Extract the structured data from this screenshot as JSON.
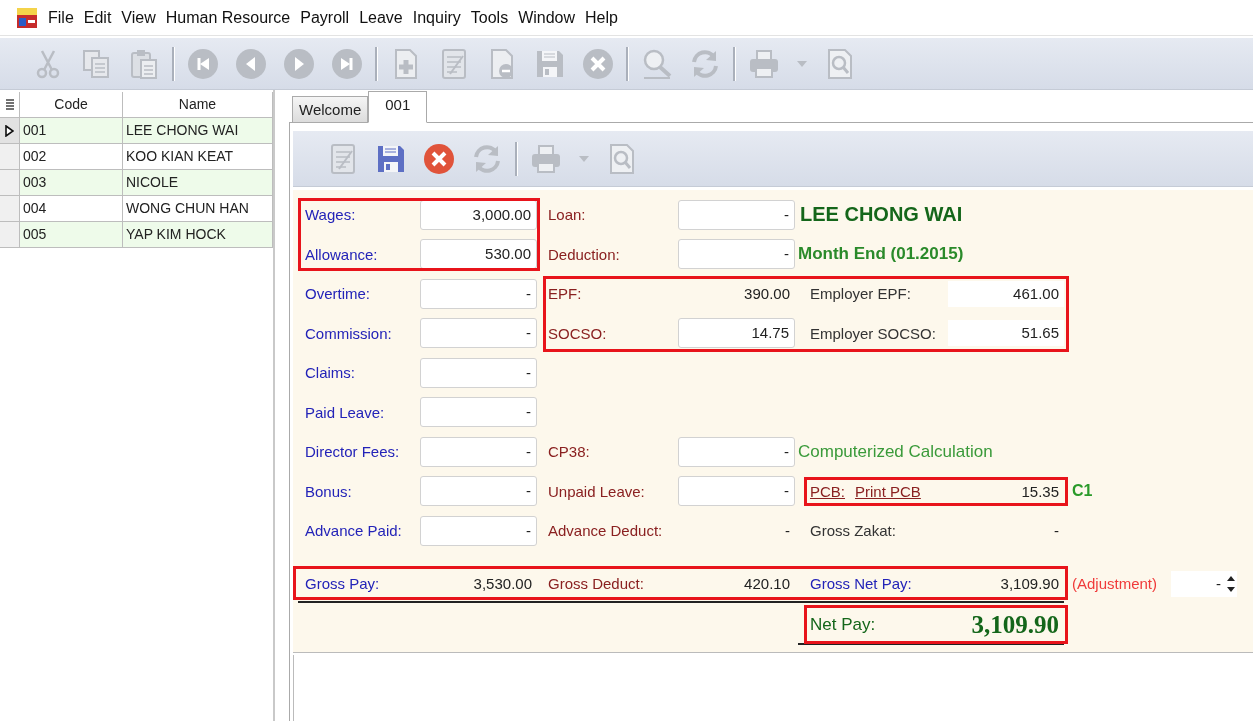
{
  "menu": [
    "File",
    "Edit",
    "View",
    "Human Resource",
    "Payroll",
    "Leave",
    "Inquiry",
    "Tools",
    "Window",
    "Help"
  ],
  "toolbar": [
    {
      "kind": "cut",
      "disabled": true
    },
    {
      "kind": "copy",
      "disabled": true
    },
    {
      "kind": "paste",
      "disabled": true
    },
    {
      "kind": "separator"
    },
    {
      "kind": "first",
      "disabled": true
    },
    {
      "kind": "previous",
      "disabled": true
    },
    {
      "kind": "next",
      "disabled": true
    },
    {
      "kind": "last",
      "disabled": true
    },
    {
      "kind": "separator"
    },
    {
      "kind": "add",
      "disabled": true
    },
    {
      "kind": "edit",
      "disabled": true
    },
    {
      "kind": "remove",
      "disabled": true
    },
    {
      "kind": "save",
      "disabled": true
    },
    {
      "kind": "cancel",
      "disabled": true
    },
    {
      "kind": "separator"
    },
    {
      "kind": "search",
      "disabled": true
    },
    {
      "kind": "refresh",
      "disabled": true
    },
    {
      "kind": "separator"
    },
    {
      "kind": "print",
      "disabled": true
    },
    {
      "kind": "dropdown",
      "disabled": true
    },
    {
      "kind": "preview",
      "disabled": true
    }
  ],
  "employee_list": {
    "columns": [
      "Code",
      "Name"
    ],
    "rows": [
      {
        "code": "001",
        "name": "LEE CHONG WAI",
        "selected": true
      },
      {
        "code": "002",
        "name": "KOO KIAN KEAT",
        "selected": false
      },
      {
        "code": "003",
        "name": "NICOLE",
        "selected": false
      },
      {
        "code": "004",
        "name": "WONG CHUN HAN",
        "selected": false
      },
      {
        "code": "005",
        "name": "YAP KIM HOCK",
        "selected": false
      }
    ]
  },
  "tabs": [
    {
      "label": "Welcome",
      "selected": false
    },
    {
      "label": "001",
      "selected": true
    }
  ],
  "record_toolbar": [
    {
      "kind": "edit",
      "disabled": true
    },
    {
      "kind": "save",
      "disabled": false
    },
    {
      "kind": "cancel",
      "disabled": false
    },
    {
      "kind": "refresh",
      "disabled": true
    },
    {
      "kind": "separator"
    },
    {
      "kind": "print",
      "disabled": true
    },
    {
      "kind": "dropdown",
      "disabled": true
    },
    {
      "kind": "preview",
      "disabled": true
    }
  ],
  "form": {
    "rows": [
      {
        "left": {
          "label": "Wages:",
          "color": "#2323b8",
          "kind": "input",
          "value": "3,000.00"
        },
        "middle": {
          "label": "Loan:",
          "color": "#8a2020",
          "kind": "input",
          "value": "-"
        },
        "right": {
          "kind": "heading",
          "text": "LEE CHONG WAI"
        }
      },
      {
        "left": {
          "label": "Allowance:",
          "color": "#2323b8",
          "kind": "input",
          "value": "530.00"
        },
        "middle": {
          "label": "Deduction:",
          "color": "#8a2020",
          "kind": "input",
          "value": "-"
        },
        "right": {
          "kind": "subheading",
          "text": "Month End (01.2015)"
        }
      },
      {
        "left": {
          "label": "Overtime:",
          "color": "#2323b8",
          "kind": "input",
          "value": "-"
        },
        "middle": {
          "label": "EPF:",
          "color": "#8a2020",
          "kind": "plain",
          "value": "390.00"
        },
        "right": {
          "label": "Employer EPF:",
          "color": "#333333",
          "kind": "shaded",
          "value": "461.00"
        }
      },
      {
        "left": {
          "label": "Commission:",
          "color": "#2323b8",
          "kind": "input",
          "value": "-"
        },
        "middle": {
          "label": "SOCSO:",
          "color": "#8a2020",
          "kind": "input",
          "value": "14.75"
        },
        "right": {
          "label": "Employer SOCSO:",
          "color": "#333333",
          "kind": "shaded",
          "value": "51.65"
        }
      },
      {
        "left": {
          "label": "Claims:",
          "color": "#2323b8",
          "kind": "input",
          "value": "-"
        }
      },
      {
        "left": {
          "label": "Paid Leave:",
          "color": "#2323b8",
          "kind": "input",
          "value": "-"
        }
      },
      {
        "left": {
          "label": "Director Fees:",
          "color": "#2323b8",
          "kind": "input",
          "value": "-"
        },
        "middle": {
          "label": "CP38:",
          "color": "#8a2020",
          "kind": "input",
          "value": "-"
        },
        "right": {
          "kind": "note",
          "text": "Computerized Calculation"
        }
      },
      {
        "left": {
          "label": "Bonus:",
          "color": "#2323b8",
          "kind": "input",
          "value": "-"
        },
        "middle": {
          "label": "Unpaid Leave:",
          "color": "#8a2020",
          "kind": "input",
          "value": "-"
        },
        "right": {
          "kind": "pcb",
          "label": "PCB:",
          "link": "Print PCB",
          "value": "15.35",
          "code": "C1"
        }
      },
      {
        "left": {
          "label": "Advance Paid:",
          "color": "#2323b8",
          "kind": "input",
          "value": "-"
        },
        "middle": {
          "label": "Advance Deduct:",
          "color": "#8a2020",
          "kind": "plain",
          "value": "-"
        },
        "right": {
          "label": "Gross Zakat:",
          "color": "#333333",
          "kind": "plain",
          "value": "-"
        }
      }
    ],
    "totals": {
      "left": {
        "label": "Gross Pay:",
        "color": "#2323b8",
        "kind": "plain",
        "value": "3,530.00"
      },
      "middle": {
        "label": "Gross Deduct:",
        "color": "#8a2020",
        "kind": "plain",
        "value": "420.10"
      },
      "right": {
        "label": "Gross Net Pay:",
        "color": "#2323b8",
        "kind": "plain",
        "value": "3,109.90"
      },
      "adjustment": {
        "label": "(Adjustment)",
        "value": "-"
      }
    },
    "net_pay": {
      "label": "Net Pay:",
      "value": "3,109.90"
    }
  }
}
